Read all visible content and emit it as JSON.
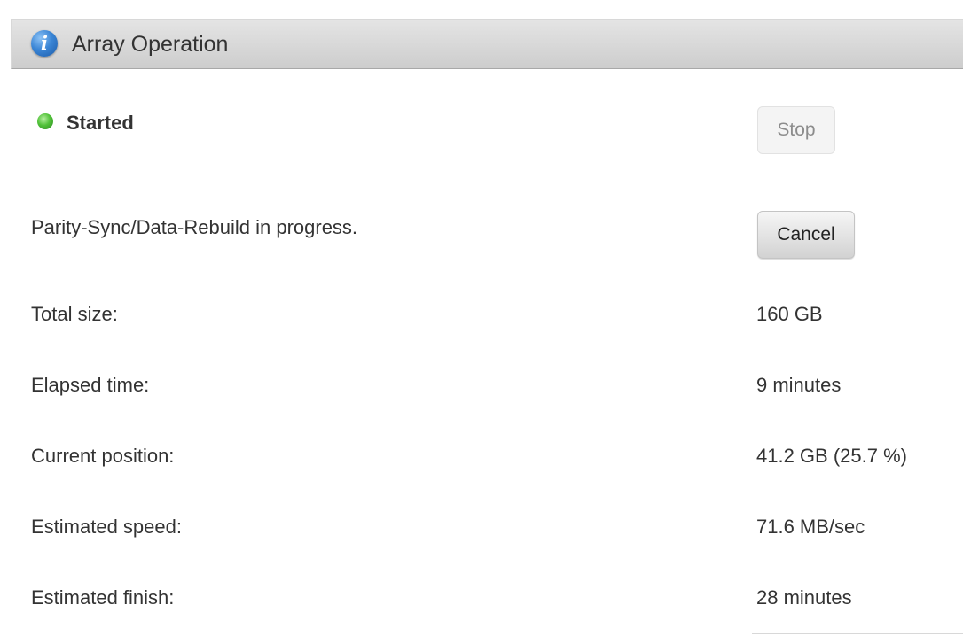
{
  "panel": {
    "title": "Array Operation",
    "icon": "info-icon"
  },
  "status": {
    "label": "Started",
    "indicator_color": "#4cbb35"
  },
  "buttons": {
    "stop_label": "Stop",
    "cancel_label": "Cancel"
  },
  "operation": {
    "message": "Parity-Sync/Data-Rebuild in progress."
  },
  "details": [
    {
      "label": "Total size:",
      "value": "160 GB"
    },
    {
      "label": "Elapsed time:",
      "value": "9 minutes"
    },
    {
      "label": "Current position:",
      "value": "41.2 GB (25.7 %)"
    },
    {
      "label": "Estimated speed:",
      "value": "71.6 MB/sec"
    },
    {
      "label": "Estimated finish:",
      "value": "28 minutes"
    }
  ]
}
